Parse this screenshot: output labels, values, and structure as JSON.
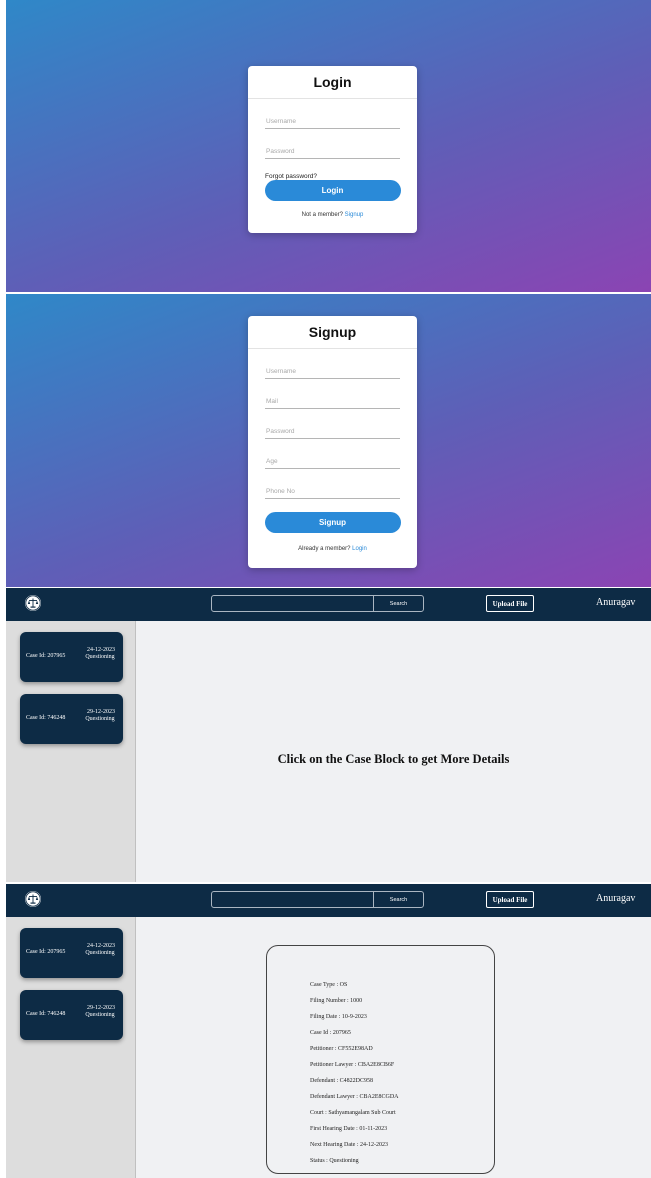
{
  "login": {
    "title": "Login",
    "username_placeholder": "Username",
    "password_placeholder": "Password",
    "forgot": "Forgot password?",
    "button": "Login",
    "prompt": "Not a member?",
    "link": "Signup"
  },
  "signup": {
    "title": "Signup",
    "fields": [
      "Username",
      "Mail",
      "Password",
      "Age",
      "Phone No"
    ],
    "button": "Signup",
    "prompt": "Already a member?",
    "link": "Login"
  },
  "navbar": {
    "search_button": "Search",
    "upload_button": "Upload File",
    "username": "Anuragav",
    "logo_icon": "scales-of-justice-icon",
    "color": "#0d2b45"
  },
  "cases": [
    {
      "id_label": "Case Id: 207965",
      "date": "24-12-2023",
      "status": "Questioning"
    },
    {
      "id_label": "Case Id: 746248",
      "date": "29-12-2023",
      "status": "Questioning"
    }
  ],
  "main": {
    "placeholder": "Click on the Case Block to get More Details"
  },
  "case_details": [
    "Case Type : OS",
    "Filing Number : 1000",
    "Filing Date : 10-9-2023",
    "Case Id : 207965",
    "Petitioner : CF552E98AD",
    "Petitioner Lawyer : CBA2E8CB6F",
    "Defendant : C4822DC958",
    "Defendant Lawyer : CBA2E8CGDA",
    "Court : Sathyamangalam Sub Court",
    "First Hearing Date : 01-11-2023",
    "Next Hearing Date : 24-12-2023",
    "Status : Questioning"
  ],
  "colors": {
    "primary_button": "#2a8ad8",
    "gradient_start": "#2f88c8",
    "gradient_end": "#8b44b3"
  }
}
